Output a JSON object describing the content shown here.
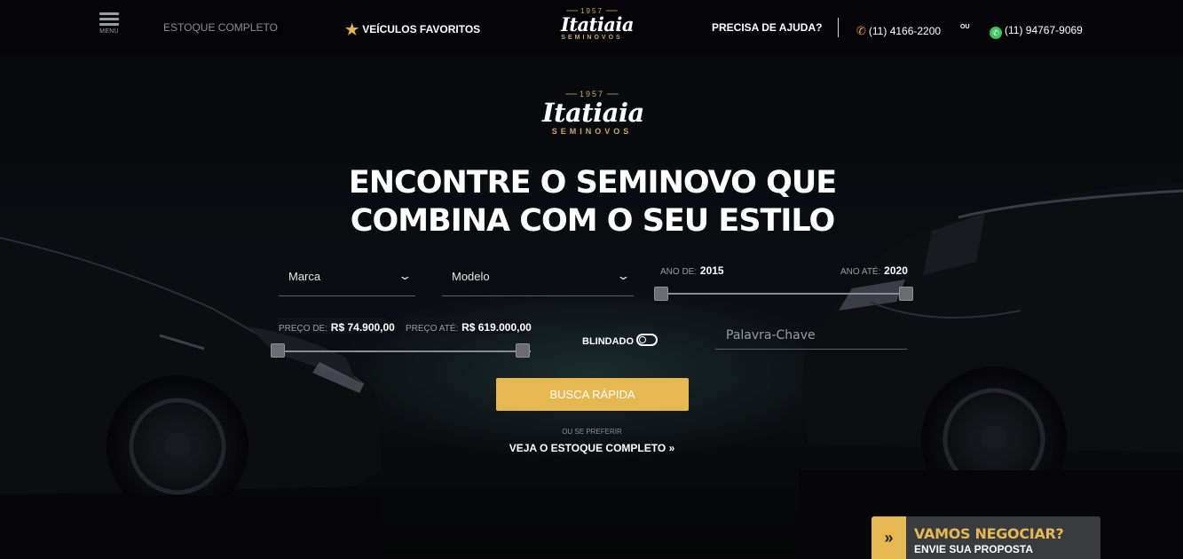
{
  "header": {
    "menu_label": "MENU",
    "estoque_label": "ESTOQUE COMPLETO",
    "favoritos_label": "VEÍCULOS FAVORITOS",
    "logo": {
      "year": "1957",
      "name": "Itatiaia",
      "sub": "SEMINOVOS"
    },
    "ajuda_label": "PRECISA DE AJUDA?",
    "phone": "(11) 4166-2200",
    "or_label": "OU",
    "whatsapp": "(11) 94767-9069"
  },
  "hero": {
    "logo": {
      "year": "1957",
      "name": "Itatiaia",
      "sub": "SEMINOVOS"
    },
    "headline_line1": "ENCONTRE O SEMINOVO QUE",
    "headline_line2": "COMBINA COM O SEU ESTILO"
  },
  "search": {
    "marca_label": "Marca",
    "modelo_label": "Modelo",
    "ano_de_label": "ANO DE:",
    "ano_de_value": "2015",
    "ano_ate_label": "ANO ATÉ:",
    "ano_ate_value": "2020",
    "preco_de_label": "PREÇO DE:",
    "preco_de_value": "R$ 74.900,00",
    "preco_ate_label": "PREÇO ATÉ:",
    "preco_ate_value": "R$ 619.000,00",
    "blindado_label": "BLINDADO",
    "blindado_on": false,
    "keyword_placeholder": "Palavra-Chave",
    "button_label": "BUSCA RÁPIDA",
    "ou_se_preferir": "OU SE PREFERIR",
    "veja_estoque": "VEJA O ESTOQUE COMPLETO"
  },
  "negociar": {
    "title": "VAMOS NEGOCIAR?",
    "subtitle": "ENVIE SUA PROPOSTA"
  },
  "colors": {
    "accent": "#e6b852",
    "background": "#0a0c10",
    "phone_icon": "#e39b4f",
    "whatsapp_icon": "#39c25c"
  },
  "icons": [
    "menu-icon",
    "star-icon",
    "phone-icon",
    "whatsapp-icon",
    "chevron-down-icon",
    "toggle-icon",
    "double-chevron-right-icon"
  ]
}
